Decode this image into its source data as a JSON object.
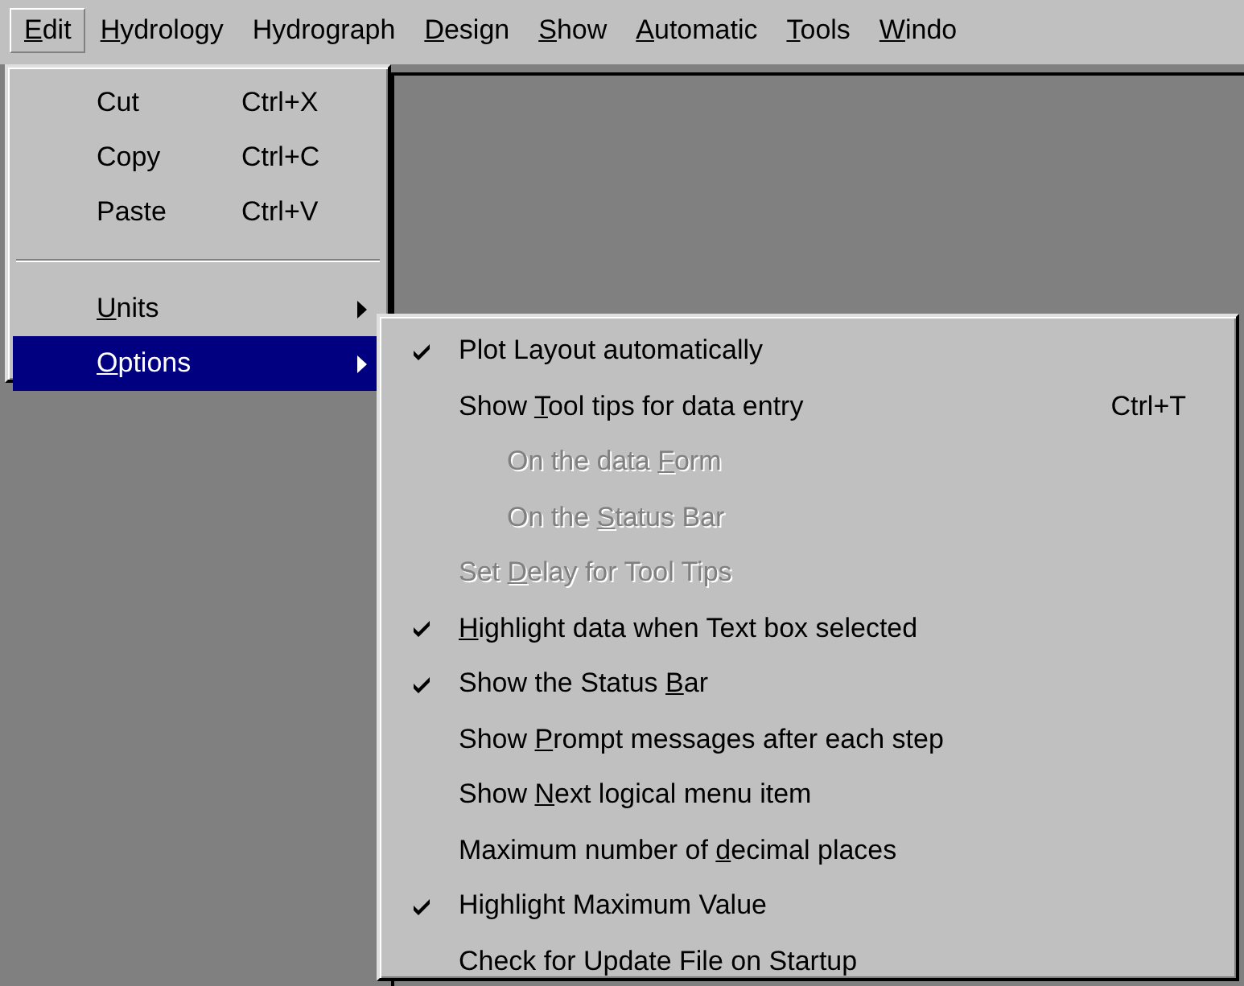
{
  "menu_bar": [
    {
      "label": {
        "key": "E",
        "post": "dit"
      },
      "selected": true
    },
    {
      "label": {
        "key": "H",
        "post": "ydrology"
      },
      "selected": false
    },
    {
      "label": {
        "pre": "Hydrograph"
      },
      "selected": false
    },
    {
      "label": {
        "key": "D",
        "post": "esign"
      },
      "selected": false
    },
    {
      "label": {
        "key": "S",
        "post": "how"
      },
      "selected": false
    },
    {
      "label": {
        "key": "A",
        "post": "utomatic"
      },
      "selected": false
    },
    {
      "label": {
        "key": "T",
        "post": "ools"
      },
      "selected": false
    },
    {
      "label": {
        "key": "W",
        "post": "indo"
      },
      "selected": false
    }
  ],
  "edit_menu": {
    "items": [
      {
        "kind": "item",
        "label": {
          "pre": "Cut"
        },
        "shortcut": "Ctrl+X",
        "selected": false
      },
      {
        "kind": "item",
        "label": {
          "pre": "Copy"
        },
        "shortcut": "Ctrl+C",
        "selected": false
      },
      {
        "kind": "item",
        "label": {
          "pre": "Paste"
        },
        "shortcut": "Ctrl+V",
        "selected": false
      },
      {
        "kind": "separator"
      },
      {
        "kind": "submenu",
        "label": {
          "key": "U",
          "post": "nits"
        },
        "selected": false
      },
      {
        "kind": "submenu",
        "label": {
          "key": "O",
          "post": "ptions"
        },
        "selected": true
      }
    ]
  },
  "options_menu": {
    "items": [
      {
        "label": {
          "pre": "Plot Layout automatically"
        },
        "checked": true,
        "disabled": false
      },
      {
        "label": {
          "pre": "Show ",
          "key": "T",
          "post": "ool tips for data entry"
        },
        "shortcut": "Ctrl+T",
        "checked": false,
        "disabled": false,
        "children": [
          {
            "label": {
              "pre": "On the data ",
              "key": "F",
              "post": "orm"
            },
            "checked": false,
            "disabled": true
          },
          {
            "label": {
              "pre": "On the ",
              "key": "S",
              "post": "tatus Bar"
            },
            "checked": false,
            "disabled": true
          }
        ]
      },
      {
        "label": {
          "pre": "Set ",
          "key": "D",
          "post": "elay for Tool Tips"
        },
        "checked": false,
        "disabled": true
      },
      {
        "label": {
          "key": "H",
          "post": "ighlight data when Text box selected"
        },
        "checked": true,
        "disabled": false
      },
      {
        "label": {
          "pre": "Show the Status ",
          "key": "B",
          "post": "ar"
        },
        "checked": true,
        "disabled": false
      },
      {
        "label": {
          "pre": "Show ",
          "key": "P",
          "post": "rompt messages after each step"
        },
        "checked": false,
        "disabled": false
      },
      {
        "label": {
          "pre": "Show ",
          "key": "N",
          "post": "ext logical menu item"
        },
        "checked": false,
        "disabled": false
      },
      {
        "label": {
          "pre": "Maximum number of ",
          "key": "d",
          "post": "ecimal places"
        },
        "checked": false,
        "disabled": false
      },
      {
        "label": {
          "pre": "Highlight Maximum Value"
        },
        "checked": true,
        "disabled": false
      },
      {
        "label": {
          "pre": "Check for Update File on Startup"
        },
        "checked": false,
        "disabled": false
      }
    ]
  }
}
